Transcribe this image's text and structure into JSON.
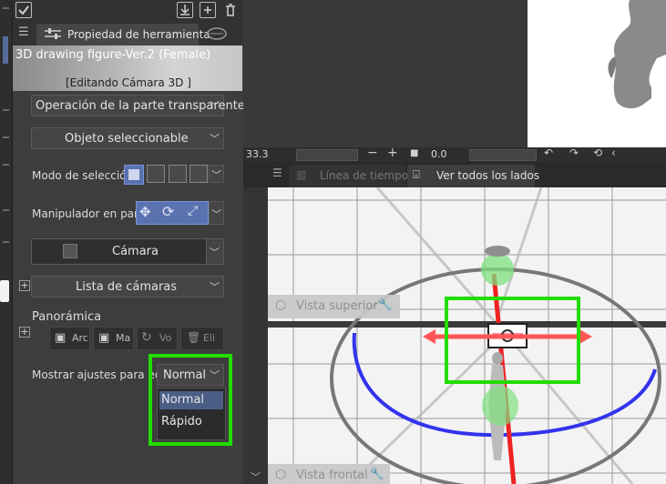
{
  "panel": {
    "tab_title": "Propiedad de herramienta",
    "thumbnail_title": "3D drawing figure-Ver.2 (Female)",
    "thumbnail_subtitle": "[Editando Cámara 3D ]",
    "transparent_op": "Operación de la parte transparente",
    "selectable": "Objeto seleccionable",
    "selection_mode_label": "Modo de selección",
    "manipulator_label": "Manipulador en pantalla",
    "camera_label": "Cámara",
    "camera_list": "Lista de cámaras",
    "panoramic_label": "Panorámica",
    "pan_buttons": [
      "Arc",
      "Ma",
      "Vo",
      "Eli"
    ],
    "show_settings_label": "Mostrar ajustes para edición",
    "show_settings_value": "Normal",
    "menu_options": [
      "Normal",
      "Rápido"
    ]
  },
  "toolbar2": {
    "zoom_value": "33.3",
    "rotation_value": "0.0"
  },
  "tabs2": {
    "timeline": "Línea de tiempo",
    "all_sides": "Ver todos los lados"
  },
  "view3d": {
    "top_view": "Vista superior",
    "front_view": "Vista frontal"
  },
  "colors": {
    "highlight": "#22dd00",
    "active_button": "#5a72b0",
    "axis_red": "#ee2222",
    "axis_blue": "#3333ee"
  }
}
